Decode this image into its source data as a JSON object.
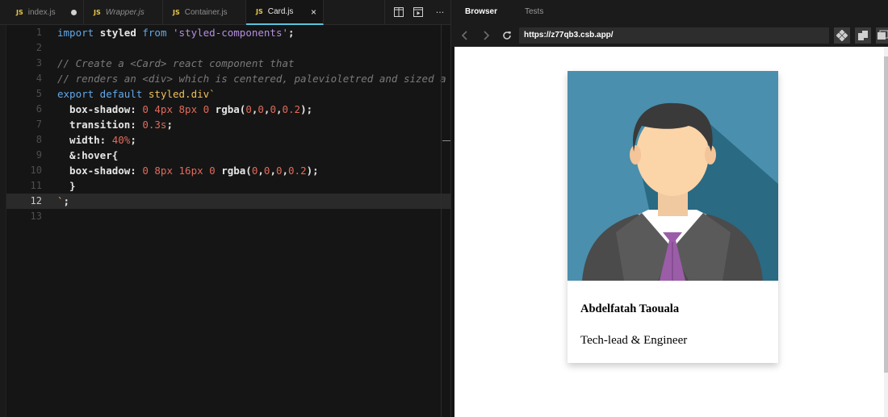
{
  "editor": {
    "tabs": [
      {
        "label": "index.js",
        "badge": "JS",
        "modified": true,
        "active": false,
        "italic": false
      },
      {
        "label": "Wrapper.js",
        "badge": "JS",
        "modified": false,
        "active": false,
        "italic": true
      },
      {
        "label": "Container.js",
        "badge": "JS",
        "modified": false,
        "active": false,
        "italic": false
      },
      {
        "label": "Card.js",
        "badge": "JS",
        "modified": false,
        "active": true,
        "italic": false,
        "close": "×"
      }
    ],
    "toolbar_icons": [
      "split-view-icon",
      "preview-icon",
      "more-icon"
    ],
    "more_label": "···",
    "current_line": 12,
    "lines": [
      {
        "n": "1",
        "parts": [
          [
            "kw",
            "import "
          ],
          [
            "bold",
            "styled "
          ],
          [
            "kw",
            "from "
          ],
          [
            "str",
            "'styled-components'"
          ],
          [
            "",
            ""
          ],
          [
            "bold",
            ";"
          ]
        ]
      },
      {
        "n": "2",
        "parts": []
      },
      {
        "n": "3",
        "parts": [
          [
            "cm",
            "// Create a <Card> react component that"
          ]
        ]
      },
      {
        "n": "4",
        "parts": [
          [
            "cm",
            "// renders an <div> which is centered, palevioletred and sized a"
          ]
        ]
      },
      {
        "n": "5",
        "parts": [
          [
            "kw",
            "export default "
          ],
          [
            "fn",
            "styled.div"
          ],
          [
            "tpl",
            "`"
          ]
        ]
      },
      {
        "n": "6",
        "parts": [
          [
            "bold",
            "  box-shadow: "
          ],
          [
            "num",
            "0 4px 8px 0 "
          ],
          [
            "bold",
            "rgba("
          ],
          [
            "num",
            "0"
          ],
          [
            "bold",
            ","
          ],
          [
            "num",
            "0"
          ],
          [
            "bold",
            ","
          ],
          [
            "num",
            "0"
          ],
          [
            "bold",
            ","
          ],
          [
            "num",
            "0.2"
          ],
          [
            "bold",
            ");"
          ]
        ]
      },
      {
        "n": "7",
        "parts": [
          [
            "bold",
            "  transition: "
          ],
          [
            "num",
            "0.3s"
          ],
          [
            "bold",
            ";"
          ]
        ]
      },
      {
        "n": "8",
        "parts": [
          [
            "bold",
            "  width: "
          ],
          [
            "num",
            "40%"
          ],
          [
            "bold",
            ";"
          ]
        ]
      },
      {
        "n": "9",
        "parts": [
          [
            "bold",
            "  &:hover{"
          ]
        ]
      },
      {
        "n": "10",
        "parts": [
          [
            "bold",
            "  box-shadow: "
          ],
          [
            "num",
            "0 8px 16px 0 "
          ],
          [
            "bold",
            "rgba("
          ],
          [
            "num",
            "0"
          ],
          [
            "bold",
            ","
          ],
          [
            "num",
            "0"
          ],
          [
            "bold",
            ","
          ],
          [
            "num",
            "0"
          ],
          [
            "bold",
            ","
          ],
          [
            "num",
            "0.2"
          ],
          [
            "bold",
            ");"
          ]
        ]
      },
      {
        "n": "11",
        "parts": [
          [
            "bold",
            "  }"
          ]
        ]
      },
      {
        "n": "12",
        "parts": [
          [
            "tpl",
            "`"
          ],
          [
            "bold",
            ";"
          ]
        ]
      },
      {
        "n": "13",
        "parts": []
      }
    ]
  },
  "browser": {
    "tabs": [
      {
        "label": "Browser",
        "active": true
      },
      {
        "label": "Tests",
        "active": false
      }
    ],
    "url": "https://z77qb3.csb.app/",
    "nav_icons": [
      "back-icon",
      "forward-icon",
      "refresh-icon"
    ],
    "action_icons": [
      "codesandbox-icon",
      "open-new-window-icon",
      "fullscreen-icon"
    ],
    "card": {
      "name": "Abdelfatah Taouala",
      "role": "Tech-lead & Engineer",
      "avatar_icon": "person-avatar-icon"
    }
  },
  "colors": {
    "editor_bg": "#151515",
    "keyword": "#62a8e8",
    "string": "#b48ee0",
    "number": "#e06a5a",
    "function": "#f0c05a",
    "comment": "#7a7a7a",
    "active_tab_accent": "#58c4dc",
    "avatar_bg": "#3f87a6",
    "avatar_shadow": "#2a6a83",
    "tie": "#9b5da8"
  }
}
